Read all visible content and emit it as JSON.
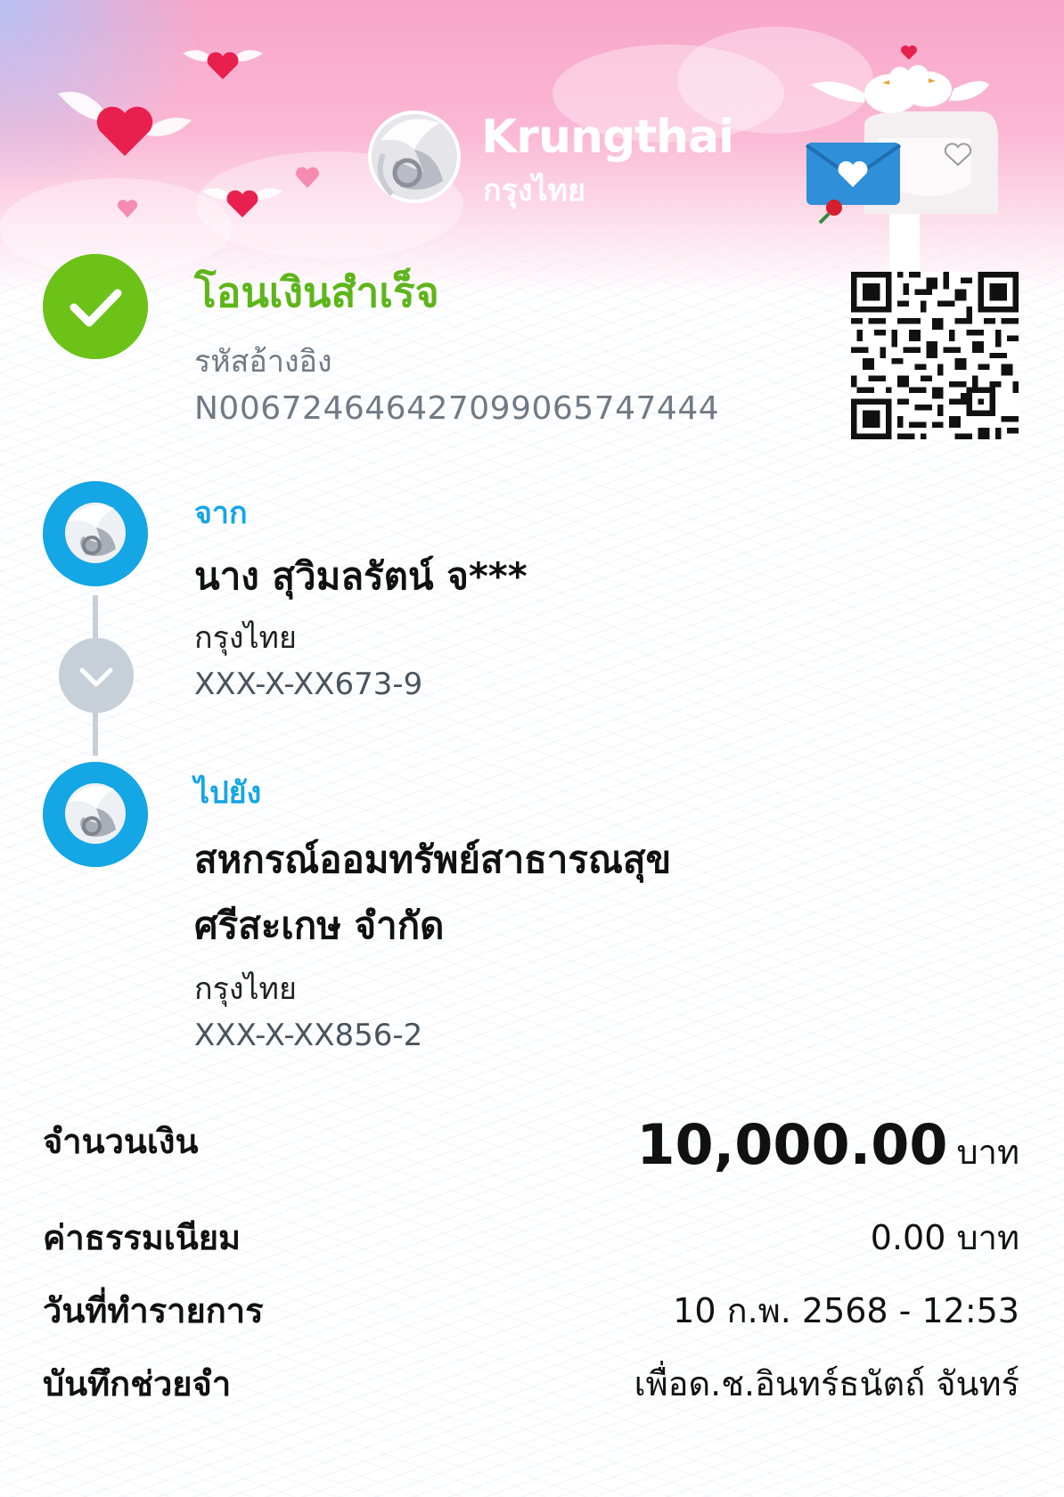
{
  "brand": {
    "name_en": "Krungthai",
    "name_th": "กรุงไทย"
  },
  "status": {
    "title": "โอนเงินสำเร็จ",
    "icon": "check-circle-icon",
    "color": "#6cc217"
  },
  "reference": {
    "label": "รหัสอ้างอิง",
    "value": "N006724646427099065747444"
  },
  "from": {
    "label": "จาก",
    "name": "นาง สุวิมลรัตน์ จ***",
    "bank": "กรุงไทย",
    "account": "XXX-X-XX673-9"
  },
  "to": {
    "label": "ไปยัง",
    "name_line1": "สหกรณ์ออมทรัพย์สาธารณสุข",
    "name_line2": "ศรีสะเกษ จำกัด",
    "bank": "กรุงไทย",
    "account": "XXX-X-XX856-2"
  },
  "details": {
    "amount_label": "จำนวนเงิน",
    "amount_value": "10,000.00",
    "amount_unit": "บาท",
    "fee_label": "ค่าธรรมเนียม",
    "fee_value": "0.00 บาท",
    "date_label": "วันที่ทำรายการ",
    "date_value": "10 ก.พ. 2568 - 12:53",
    "memo_label": "บันทึกช่วยจำ",
    "memo_value": "เพื่อด.ช.อินทร์ธนัตถ์ จันทร์"
  },
  "colors": {
    "accent": "#14a6e5",
    "success": "#6cc217",
    "header_pink": "#f7a6c9"
  }
}
